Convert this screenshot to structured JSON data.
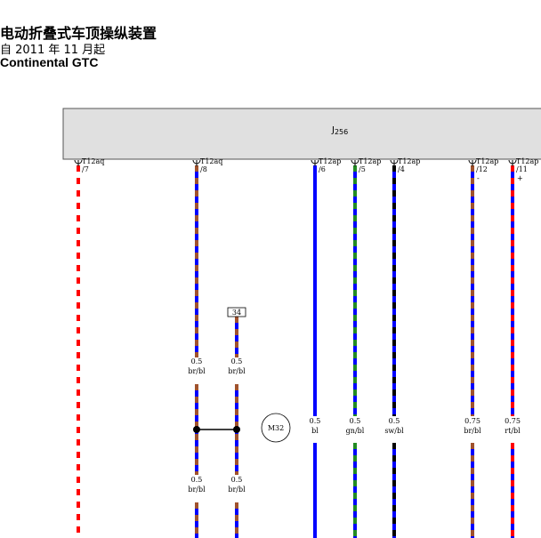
{
  "header": {
    "title": "电动折叠式车顶操纵装置",
    "since": "自 2011 年 11 月起",
    "model": "Continental GTC"
  },
  "control_unit": {
    "label": "J",
    "subscript": "256"
  },
  "pins": [
    {
      "connector": "T12aq",
      "pin": "/7",
      "sign": ""
    },
    {
      "connector": "T12aq",
      "pin": "/8",
      "sign": ""
    },
    {
      "connector": "T12ap",
      "pin": "/6",
      "sign": ""
    },
    {
      "connector": "T12ap",
      "pin": "/5",
      "sign": ""
    },
    {
      "connector": "T12ap",
      "pin": "/4",
      "sign": ""
    },
    {
      "connector": "T12ap",
      "pin": "/12",
      "sign": "-"
    },
    {
      "connector": "T12ap",
      "pin": "/11",
      "sign": "+"
    }
  ],
  "wires": [
    {
      "id": "w1",
      "colors": [
        "#ff0000",
        "#ffffff"
      ],
      "size": "",
      "code": ""
    },
    {
      "id": "w2",
      "colors": [
        "#a0522d",
        "#0000ff"
      ],
      "size": "0.5",
      "code": "br/bl",
      "size2": "0.5",
      "code2": "br/bl"
    },
    {
      "id": "w3",
      "colors": [
        "#a0522d",
        "#0000ff"
      ],
      "size": "0.5",
      "code": "br/bl",
      "size2": "0.5",
      "code2": "br/bl"
    },
    {
      "id": "w4",
      "colors": [
        "#0000ff",
        "#0000ff"
      ],
      "size": "0.5",
      "code": "bl"
    },
    {
      "id": "w5",
      "colors": [
        "#228b22",
        "#0000ff"
      ],
      "size": "0.5",
      "code": "gn/bl"
    },
    {
      "id": "w6",
      "colors": [
        "#000000",
        "#0000ff"
      ],
      "size": "0.5",
      "code": "sw/bl"
    },
    {
      "id": "w7",
      "colors": [
        "#a0522d",
        "#0000ff"
      ],
      "size": "0.75",
      "code": "br/bl"
    },
    {
      "id": "w8",
      "colors": [
        "#ff0000",
        "#0000ff"
      ],
      "size": "0.75",
      "code": "rt/bl"
    }
  ],
  "ground_box": {
    "label": "34"
  },
  "motor": {
    "label": "M32"
  }
}
